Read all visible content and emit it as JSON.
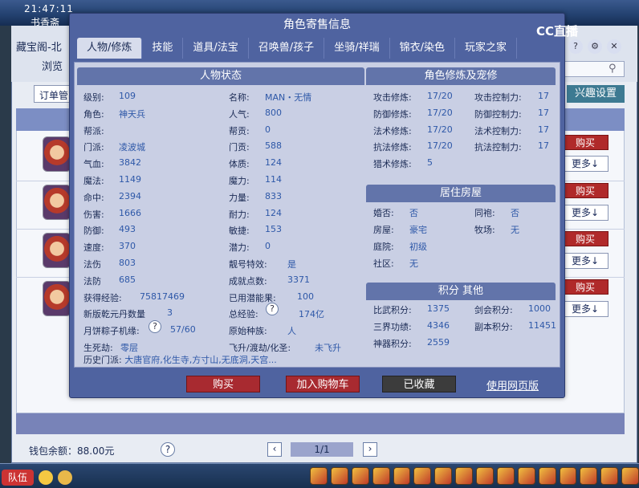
{
  "background": {
    "clock": "21:47:11",
    "book_label": "书香斋",
    "shop_title": "藏宝阁-北",
    "browse_label": "浏览",
    "order_label": "订单管",
    "interest_label": "兴趣设置",
    "buy_label": "购买",
    "more_label": "更多↓",
    "wallet": "钱包余额：88.00元",
    "page": "1/1",
    "team_label": "队伍"
  },
  "modal": {
    "title": "角色寄售信息",
    "logo": "CC直播",
    "tabs": [
      {
        "label": "人物/修炼"
      },
      {
        "label": "技能"
      },
      {
        "label": "道具/法宝"
      },
      {
        "label": "召唤兽/孩子"
      },
      {
        "label": "坐骑/祥瑞"
      },
      {
        "label": "锦衣/染色"
      },
      {
        "label": "玩家之家"
      }
    ],
    "status_title": "人物状态",
    "left_col": [
      {
        "k": "级别:",
        "v": "109"
      },
      {
        "k": "角色:",
        "v": "神天兵"
      },
      {
        "k": "帮派:",
        "v": ""
      },
      {
        "k": "门派:",
        "v": "凌波城"
      },
      {
        "k": "气血:",
        "v": "3842"
      },
      {
        "k": "魔法:",
        "v": "1149"
      },
      {
        "k": "命中:",
        "v": "2394"
      },
      {
        "k": "伤害:",
        "v": "1666"
      },
      {
        "k": "防御:",
        "v": "493"
      },
      {
        "k": "速度:",
        "v": "370"
      },
      {
        "k": "法伤",
        "v": "803"
      },
      {
        "k": "法防",
        "v": "685"
      },
      {
        "k": "获得经验:",
        "v": "75817469"
      },
      {
        "k": "新版乾元丹数量",
        "v": "3"
      },
      {
        "k": "月饼粽子机缘:",
        "v": "57/60"
      },
      {
        "k": "生死劫:",
        "v": "零层"
      }
    ],
    "mid_col": [
      {
        "k": "名称:",
        "v": "MAN・无情"
      },
      {
        "k": "人气:",
        "v": "800"
      },
      {
        "k": "帮贡:",
        "v": "0"
      },
      {
        "k": "门贡:",
        "v": "588"
      },
      {
        "k": "体质:",
        "v": "124"
      },
      {
        "k": "魔力:",
        "v": "114"
      },
      {
        "k": "力量:",
        "v": "833"
      },
      {
        "k": "耐力:",
        "v": "124"
      },
      {
        "k": "敏捷:",
        "v": "153"
      },
      {
        "k": "潜力:",
        "v": "0"
      },
      {
        "k": "靓号特效:",
        "v": "是"
      },
      {
        "k": "成就点数:",
        "v": "3371"
      },
      {
        "k": "已用潜能果:",
        "v": "100"
      },
      {
        "k": "总经验:",
        "v": "174亿"
      },
      {
        "k": "原始种族:",
        "v": "人"
      },
      {
        "k": "飞升/渡劫/化圣:",
        "v": "未飞升"
      }
    ],
    "history": {
      "k": "历史门派:",
      "v": "大唐官府,化生寺,方寸山,无底洞,天宫..."
    },
    "cultivation_title": "角色修炼及宠修",
    "cultivation": [
      {
        "k": "攻击修炼:",
        "v": "17/20",
        "k2": "攻击控制力:",
        "v2": "17"
      },
      {
        "k": "防御修炼:",
        "v": "17/20",
        "k2": "防御控制力:",
        "v2": "17"
      },
      {
        "k": "法术修炼:",
        "v": "17/20",
        "k2": "法术控制力:",
        "v2": "17"
      },
      {
        "k": "抗法修炼:",
        "v": "17/20",
        "k2": "抗法控制力:",
        "v2": "17"
      },
      {
        "k": "猎术修炼:",
        "v": "5",
        "k2": "",
        "v2": ""
      }
    ],
    "house_title": "居住房屋",
    "house": [
      {
        "k": "婚否:",
        "v": "否",
        "k2": "同袍:",
        "v2": "否"
      },
      {
        "k": "房屋:",
        "v": "豪宅",
        "k2": "牧场:",
        "v2": "无"
      },
      {
        "k": "庭院:",
        "v": "初级",
        "k2": "",
        "v2": ""
      },
      {
        "k": "社区:",
        "v": "无",
        "k2": "",
        "v2": ""
      }
    ],
    "score_title": "积分 其他",
    "score": [
      {
        "k": "比武积分:",
        "v": "1375",
        "k2": "剑会积分:",
        "v2": "1000"
      },
      {
        "k": "三界功绩:",
        "v": "4346",
        "k2": "副本积分:",
        "v2": "11451"
      },
      {
        "k": "神器积分:",
        "v": "2559",
        "k2": "",
        "v2": ""
      }
    ],
    "buy_button": "购买",
    "cart_button": "加入购物车",
    "saved_button": "已收藏",
    "web_link": "使用网页版"
  }
}
